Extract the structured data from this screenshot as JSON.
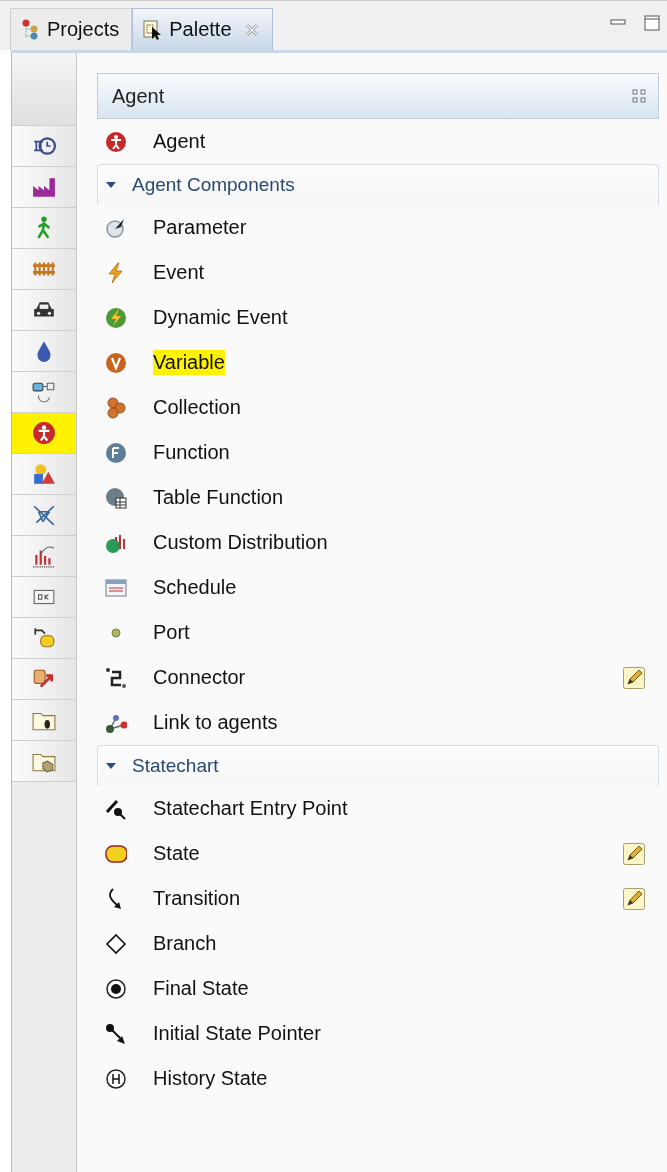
{
  "tabs": [
    {
      "label": "Projects",
      "selected": false,
      "closable": false
    },
    {
      "label": "Palette",
      "selected": true,
      "closable": true
    }
  ],
  "sidebar": {
    "items": [
      {
        "selected": false
      },
      {
        "selected": false
      },
      {
        "selected": false
      },
      {
        "selected": false
      },
      {
        "selected": false
      },
      {
        "selected": false
      },
      {
        "selected": false
      },
      {
        "selected": true
      },
      {
        "selected": false
      },
      {
        "selected": false
      },
      {
        "selected": false
      },
      {
        "selected": false
      },
      {
        "selected": false
      },
      {
        "selected": false
      },
      {
        "selected": false
      },
      {
        "selected": false
      }
    ]
  },
  "palette": {
    "title": "Agent",
    "items": [
      {
        "label": "Agent",
        "highlighted": false,
        "editable": false
      }
    ],
    "sections": [
      {
        "title": "Agent Components",
        "expanded": true,
        "items": [
          {
            "label": "Parameter",
            "highlighted": false,
            "editable": false
          },
          {
            "label": "Event",
            "highlighted": false,
            "editable": false
          },
          {
            "label": "Dynamic Event",
            "highlighted": false,
            "editable": false
          },
          {
            "label": "Variable",
            "highlighted": true,
            "editable": false
          },
          {
            "label": "Collection",
            "highlighted": false,
            "editable": false
          },
          {
            "label": "Function",
            "highlighted": false,
            "editable": false
          },
          {
            "label": "Table Function",
            "highlighted": false,
            "editable": false
          },
          {
            "label": "Custom Distribution",
            "highlighted": false,
            "editable": false
          },
          {
            "label": "Schedule",
            "highlighted": false,
            "editable": false
          },
          {
            "label": "Port",
            "highlighted": false,
            "editable": false
          },
          {
            "label": "Connector",
            "highlighted": false,
            "editable": true
          },
          {
            "label": "Link to agents",
            "highlighted": false,
            "editable": false
          }
        ]
      },
      {
        "title": "Statechart",
        "expanded": true,
        "items": [
          {
            "label": "Statechart Entry Point",
            "highlighted": false,
            "editable": false
          },
          {
            "label": "State",
            "highlighted": false,
            "editable": true
          },
          {
            "label": "Transition",
            "highlighted": false,
            "editable": true
          },
          {
            "label": "Branch",
            "highlighted": false,
            "editable": false
          },
          {
            "label": "Final State",
            "highlighted": false,
            "editable": false
          },
          {
            "label": "Initial State Pointer",
            "highlighted": false,
            "editable": false
          },
          {
            "label": "History State",
            "highlighted": false,
            "editable": false
          }
        ]
      }
    ]
  }
}
